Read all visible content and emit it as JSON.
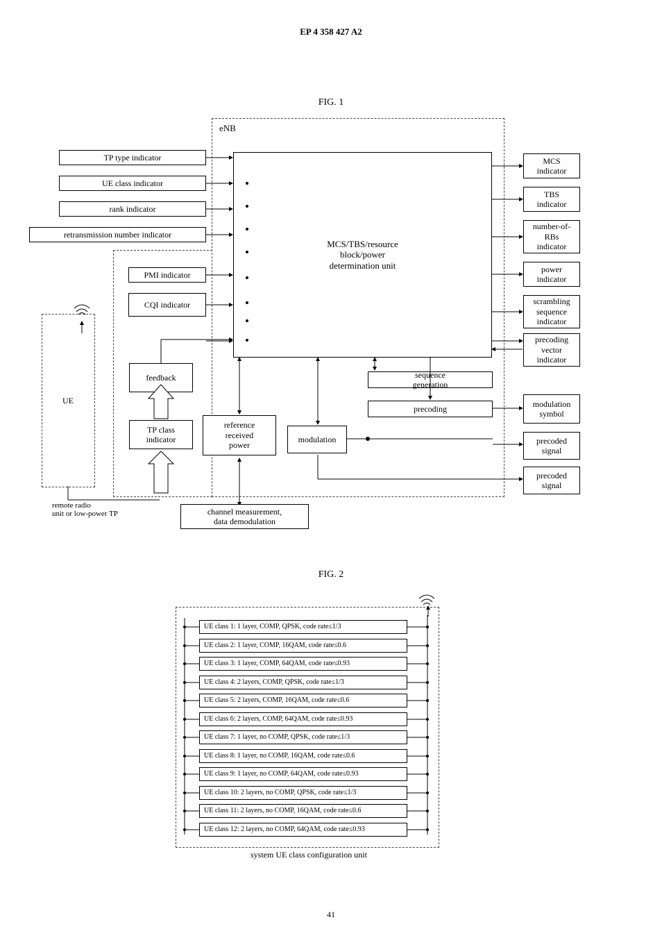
{
  "page_header": "EP 4 358 427 A2",
  "page_number": "41",
  "fig1": {
    "title": "FIG. 1",
    "inputs": {
      "tp_type": "TP type indicator",
      "ue_class": "UE class indicator",
      "rank": "rank indicator",
      "retx": "retransmission number indicator",
      "pmi": "PMI indicator",
      "cqi": "CQI indicator"
    },
    "center_block": "MCS/TBS/resource\nblock/power\ndetermination unit",
    "outputs": {
      "mcs": "MCS\nindicator",
      "tbs": "TBS\nindicator",
      "numrb": "number-of-\nRBs\nindicator",
      "power": "power\nindicator",
      "scrambling": "scrambling\nsequence\nindicator",
      "precoding": "precoding\nvector\nindicator",
      "modsym": "modulation\nsymbol",
      "signal": "precoded\nsignal"
    },
    "lower": {
      "feedback": "feedback",
      "tpclass": "TP class\nindicator",
      "eNB": "eNB",
      "rrp": "reference\nreceived\npower",
      "modulation": "modulation",
      "precoding": "precoding",
      "seqgen": "sequence\ngeneration"
    },
    "external": {
      "ue": "UE",
      "remote": "remote radio\nunit or low-power TP"
    },
    "bottom_info": "channel measurement,\ndata demodulation"
  },
  "fig2": {
    "title": "FIG. 2",
    "caption": "system UE class configuration unit",
    "rows": [
      "UE class 1: 1 layer, COMP, QPSK, code rate≤1/3",
      "UE class 2: 1 layer, COMP, 16QAM, code rate≤0.6",
      "UE class 3: 1 layer, COMP, 64QAM, code rate≤0.93",
      "UE class 4: 2 layers, COMP, QPSK, code rate≤1/3",
      "UE class 5: 2 layers, COMP, 16QAM, code rate≤0.6",
      "UE class 6: 2 layers, COMP, 64QAM, code rate≤0.93",
      "UE class 7: 1 layer, no COMP, QPSK, code rate≤1/3",
      "UE class 8: 1 layer, no COMP, 16QAM, code rate≤0.6",
      "UE class 9: 1 layer, no COMP, 64QAM, code rate≤0.93",
      "UE class 10: 2 layers, no COMP, QPSK, code rate≤1/3",
      "UE class 11: 2 layers, no COMP, 16QAM, code rate≤0.6",
      "UE class 12: 2 layers, no COMP, 64QAM, code rate≤0.93"
    ]
  }
}
